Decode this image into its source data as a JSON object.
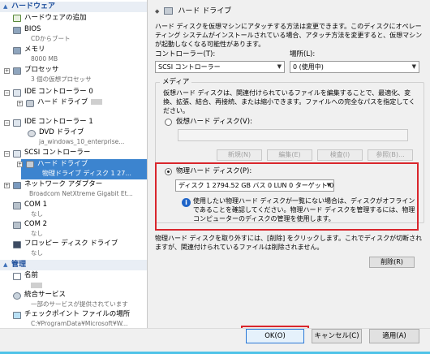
{
  "colors": {
    "accent": "#3c84cf",
    "highlight": "#d9262c",
    "section": "#1e4f9c",
    "info": "#1e64c8"
  },
  "tree": {
    "section_hardware": "ハードウェア",
    "add_hardware": "ハードウェアの追加",
    "bios": {
      "label": "BIOS",
      "sub": "CDからブート"
    },
    "memory": {
      "label": "メモリ",
      "sub": "8000 MB"
    },
    "processor": {
      "label": "プロセッサ",
      "sub": "3 個の仮想プロセッサ"
    },
    "ide0": {
      "label": "IDE コントローラー 0",
      "child": "ハード ドライブ"
    },
    "ide1": {
      "label": "IDE コントローラー 1",
      "child": "DVD ドライブ",
      "child_sub": "ja_windows_10_enterprise..."
    },
    "scsi": {
      "label": "SCSI コントローラー",
      "child": "ハード ドライブ",
      "child_sub": "物理ドライブ ディスク 1 27..."
    },
    "network": {
      "label": "ネットワーク アダプター",
      "sub": "Broadcom NetXtreme Gigabit Et..."
    },
    "com1": {
      "label": "COM 1",
      "sub": "なし"
    },
    "com2": {
      "label": "COM 2",
      "sub": "なし"
    },
    "floppy": {
      "label": "フロッピー ディスク ドライブ",
      "sub": "なし"
    },
    "section_management": "管理",
    "name": {
      "label": "名前"
    },
    "integration": {
      "label": "統合サービス",
      "sub": "一部のサービスが提供されています"
    },
    "checkpoint": {
      "label": "チェックポイント ファイルの場所",
      "sub": "C:¥ProgramData¥Microsoft¥W..."
    }
  },
  "panel": {
    "title": "ハード ドライブ",
    "intro": "ハード ディスクを仮想マシンにアタッチする方法は変更できます。このディスクにオペレーティング システムがインストールされている場合、アタッチ方法を変更すると、仮想マシンが起動しなくなる可能性があります。",
    "controller_label": "コントローラー(T):",
    "controller_value": "SCSI コントローラー",
    "location_label": "場所(L):",
    "location_value": "0 (使用中)",
    "media_label": "メディア",
    "media_text": "仮想ハード ディスクは、関連付けられているファイルを編集することで、最適化、変換、拡張、結合、再接続、または縮小できます。ファイルへの完全なパスを指定してください。",
    "virtual_disk_label": "仮想ハード ディスク(V):",
    "new_btn": "新規(N)",
    "edit_btn": "編集(E)",
    "inspect_btn": "検査(I)",
    "browse_btn": "参照(B)...",
    "physical_disk_label": "物理ハード ディスク(P):",
    "physical_disk_value": "ディスク 1 2794.52 GB バス 0 LUN 0 ターゲット 0",
    "info_text": "使用したい物理ハード ディスクが一覧にない場合は、ディスクがオフラインであることを確認してください。物理ハード ディスクを管理するには、物理コンピューターのディスクの管理を使用します。",
    "remove_text": "物理ハード ディスクを取り外すには、[削除] をクリックします。これでディスクが切断されますが、関連付けられているファイルは削除されません。",
    "remove_btn": "削除(R)"
  },
  "footer": {
    "ok": "OK(O)",
    "cancel": "キャンセル(C)",
    "apply": "適用(A)"
  }
}
